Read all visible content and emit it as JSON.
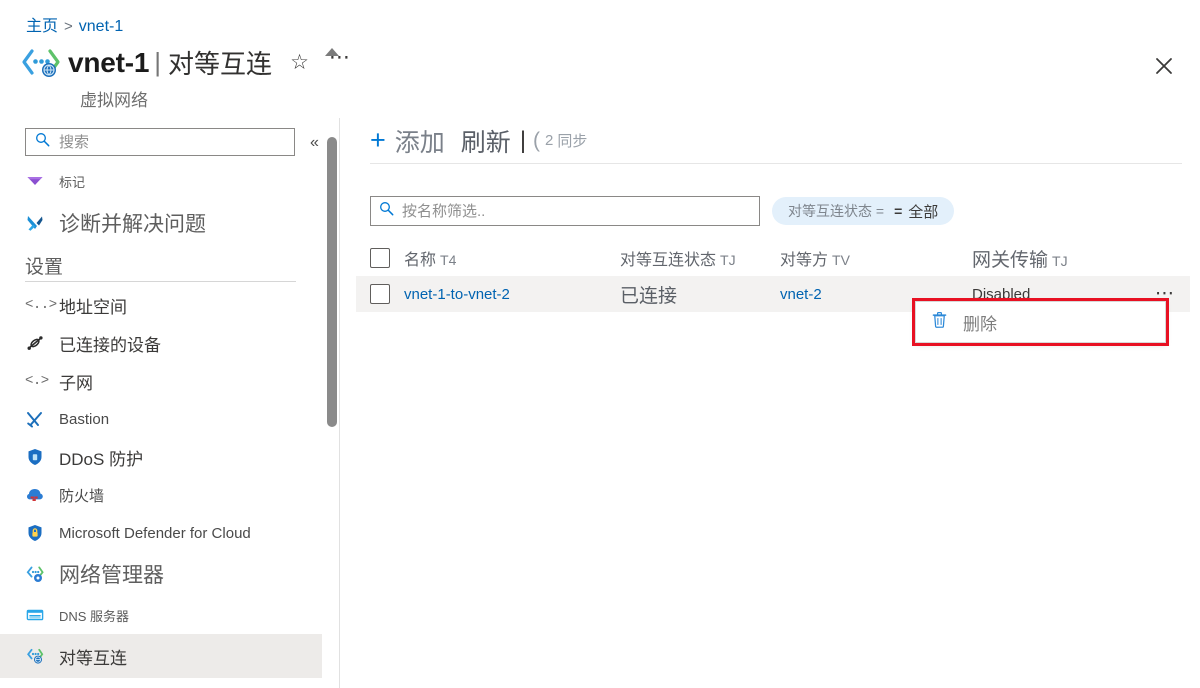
{
  "breadcrumb": {
    "home": "主页",
    "separator": ">",
    "current": "vnet-1"
  },
  "header": {
    "resource_icon": "virtual-network-icon",
    "title": "vnet-1",
    "pipe": "|",
    "page": "对等互连",
    "subtitle": "虚拟网络",
    "favorite_icon": "star-outline-icon",
    "more_icon": "ellipsis-icon",
    "close_icon": "close-icon"
  },
  "sidebar": {
    "search_placeholder": "搜索",
    "search_value": "",
    "search_icon": "search-icon",
    "collapse_icon": "chevron-double-left-icon",
    "items": [
      {
        "label": "标记",
        "icon": "tag-icon",
        "size": "tiny",
        "selected": false
      },
      {
        "label": "诊断并解决问题",
        "icon": "troubleshoot-icon",
        "size": "big",
        "selected": false
      },
      {
        "label": "地址空间",
        "icon": "address-space-icon",
        "size": "mid",
        "selected": false
      },
      {
        "label": "已连接的设备",
        "icon": "connected-devices-icon",
        "size": "mid",
        "selected": false
      },
      {
        "label": "子网",
        "icon": "subnet-icon",
        "size": "mid",
        "selected": false
      },
      {
        "label": "Bastion",
        "icon": "bastion-icon",
        "size": "default",
        "selected": false
      },
      {
        "label": "DDoS 防护",
        "icon": "ddos-shield-icon",
        "size": "mid",
        "selected": false
      },
      {
        "label": "防火墙",
        "icon": "firewall-icon",
        "size": "default",
        "selected": false
      },
      {
        "label": "Microsoft Defender for Cloud",
        "icon": "defender-shield-icon",
        "size": "default",
        "selected": false
      },
      {
        "label": "网络管理器",
        "icon": "network-manager-icon",
        "size": "big",
        "selected": false
      },
      {
        "label": "DNS 服务器",
        "icon": "dns-server-icon",
        "size": "tiny",
        "selected": false
      },
      {
        "label": "对等互连",
        "icon": "peering-icon",
        "size": "mid",
        "selected": true
      }
    ],
    "section_header": "设置"
  },
  "toolbar": {
    "add_icon": "plus-icon",
    "add_label": "添加",
    "refresh_label": "刷新",
    "separator": "|",
    "sync_icon": "sync-arc-icon",
    "sync_count": "2",
    "sync_label": "同步"
  },
  "filters": {
    "name_filter_placeholder": "按名称筛选..",
    "name_filter_value": "",
    "search_icon": "search-icon",
    "pill": {
      "label": "对等互连状态 =",
      "operator": "=",
      "value": "全部"
    }
  },
  "table": {
    "columns": [
      {
        "label": "名称",
        "sort_code": "T4"
      },
      {
        "label": "对等互连状态",
        "sort_code": "TJ"
      },
      {
        "label": "对等方",
        "sort_code": "TV"
      },
      {
        "label": "网关传输",
        "sort_code": "TJ"
      }
    ],
    "rows": [
      {
        "name": "vnet-1-to-vnet-2",
        "state": "已连接",
        "peer": "vnet-2",
        "gateway_transit": "Disabled",
        "row_menu_icon": "ellipsis-icon"
      }
    ]
  },
  "context_menu": {
    "delete_icon": "trash-icon",
    "delete_label": "删除",
    "highlight_color": "#e81123"
  },
  "colors": {
    "accent_blue": "#0078d4",
    "link_blue": "#0063b1",
    "row_hover": "#f3f2f1",
    "pill_bg": "#e3f0fb",
    "selected_nav": "#edebe9"
  }
}
